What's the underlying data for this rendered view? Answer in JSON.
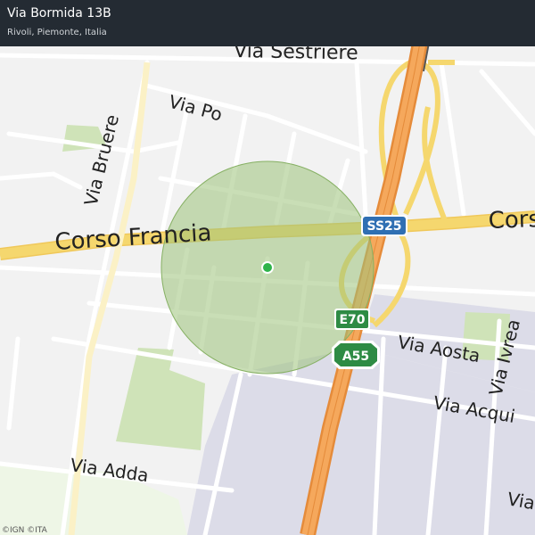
{
  "header": {
    "address": "Via Bormida 13B",
    "locality": "Rivoli, Piemonte, Italia"
  },
  "map": {
    "streets": {
      "sestriere": "Via Sestriere",
      "po": "Via Po",
      "bruere": "Via Bruere",
      "corso_francia": "Corso Francia",
      "corso_right": "Cors",
      "aosta": "Via Aosta",
      "ivrea": "Via Ivrea",
      "acqui": "Via Acqui",
      "adda": "Via Adda",
      "via_bottom_right": "Via"
    },
    "shields": {
      "ss25": "SS25",
      "e70": "E70",
      "a55": "A55"
    },
    "colors": {
      "background": "#f2f2f2",
      "main_road": "#f5d76e",
      "motorway": "#f0a050",
      "park": "#cfe3b8",
      "industrial": "#dcdce8",
      "accuracy_circle": "#9cc27a",
      "location_dot": "#2fb34a"
    }
  },
  "attribution": "©IGN ©ITA",
  "logo": "here"
}
